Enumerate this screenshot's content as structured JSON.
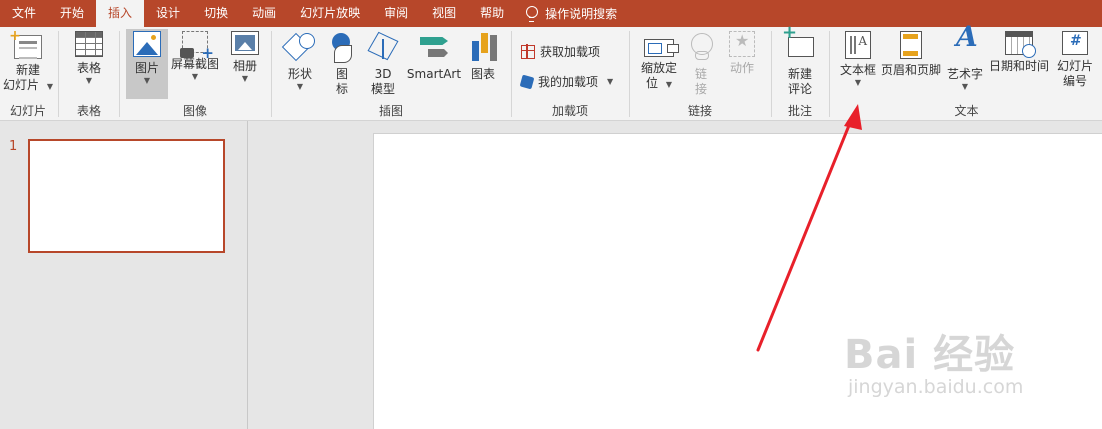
{
  "tabs": [
    "文件",
    "开始",
    "插入",
    "设计",
    "切换",
    "动画",
    "幻灯片放映",
    "审阅",
    "视图",
    "帮助"
  ],
  "active_tab": "插入",
  "tell_me": "操作说明搜索",
  "ribbon": {
    "slides": {
      "label": "幻灯片",
      "new_slide": [
        "新建",
        "幻灯片"
      ]
    },
    "tables": {
      "label": "表格",
      "table": "表格"
    },
    "images": {
      "label": "图像",
      "picture": "图片",
      "screenshot": "屏幕截图",
      "album": "相册"
    },
    "illustrations": {
      "label": "插图",
      "shapes": "形状",
      "icons": [
        "图",
        "标"
      ],
      "model3d": [
        "3D",
        "模型"
      ],
      "smartart": "SmartArt",
      "chart": "图表"
    },
    "addins": {
      "label": "加载项",
      "get": "获取加载项",
      "my": "我的加载项"
    },
    "links": {
      "label": "链接",
      "zoom": [
        "缩放定",
        "位"
      ],
      "link": [
        "链",
        "接"
      ],
      "action": "动作"
    },
    "comments": {
      "label": "批注",
      "new_comment": [
        "新建",
        "评论"
      ]
    },
    "text": {
      "label": "文本",
      "textbox": "文本框",
      "header_footer": "页眉和页脚",
      "wordart": "艺术字",
      "datetime": "日期和时间",
      "slide_number": [
        "幻灯片",
        "编号"
      ]
    }
  },
  "thumbnails": [
    {
      "number": "1"
    }
  ],
  "watermark": {
    "main": "Bai 经验",
    "sub": "jingyan.baidu.com"
  },
  "colors": {
    "accent": "#b7472a",
    "arrow": "#e8202a"
  }
}
